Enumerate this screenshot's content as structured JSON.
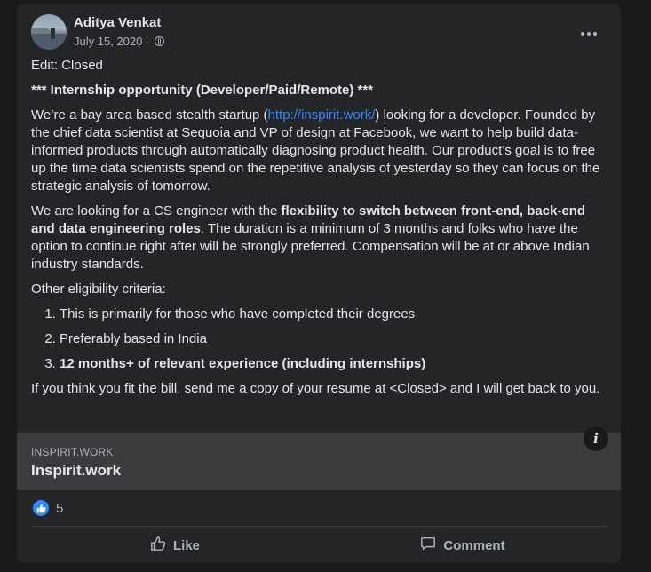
{
  "post": {
    "author": "Aditya Venkat",
    "date": "July 15, 2020",
    "separator": "·",
    "edit_line": "Edit: Closed",
    "headline": "*** Internship opportunity (Developer/Paid/Remote) ***",
    "p1_before": "We’re a bay area based stealth startup (",
    "p1_link": "http://inspirit.work/",
    "p1_after": ") looking for a developer. Founded by the chief data scientist at Sequoia and VP of design at Facebook, we want to help build data-informed products through automatically diagnosing product health. Our product’s goal is to free up the time data scientists spend on the repetitive analysis of yesterday so they can focus on the strategic analysis of tomorrow.",
    "p2_before": "We are looking for a CS engineer with the ",
    "p2_bold": "flexibility to switch between front-end, back-end and data engineering roles",
    "p2_after": ". The duration is a minimum of 3 months and folks who have the option to continue right after will be strongly preferred. Compensation will be at or above Indian industry standards.",
    "criteria_heading": "Other eligibility criteria:",
    "criteria": [
      "This is primarily for those who have completed their degrees",
      "Preferably based in India"
    ],
    "criteria3_before": "12 months+ of ",
    "criteria3_underlined": "relevant",
    "criteria3_after": " experience (including internships)",
    "closing": "If you think you fit the bill, send me a copy of your resume at <Closed> and I will get back to you."
  },
  "link_preview": {
    "domain": "INSPIRIT.WORK",
    "title": "Inspirit.work",
    "info_glyph": "i"
  },
  "reactions": {
    "count": "5"
  },
  "actions": {
    "like": "Like",
    "comment": "Comment"
  },
  "icons": {
    "avatar": "avatar-photo",
    "privacy": "globe-icon",
    "more": "more-options-icon",
    "info": "info-icon",
    "reaction": "thumbs-up-icon",
    "like": "like-icon",
    "comment": "comment-icon"
  },
  "colors": {
    "card_bg": "#242526",
    "page_bg": "#18191a",
    "text_primary": "#e4e6eb",
    "text_secondary": "#b0b3b8",
    "link": "#2d88ff",
    "preview_bg": "#3a3b3c"
  }
}
